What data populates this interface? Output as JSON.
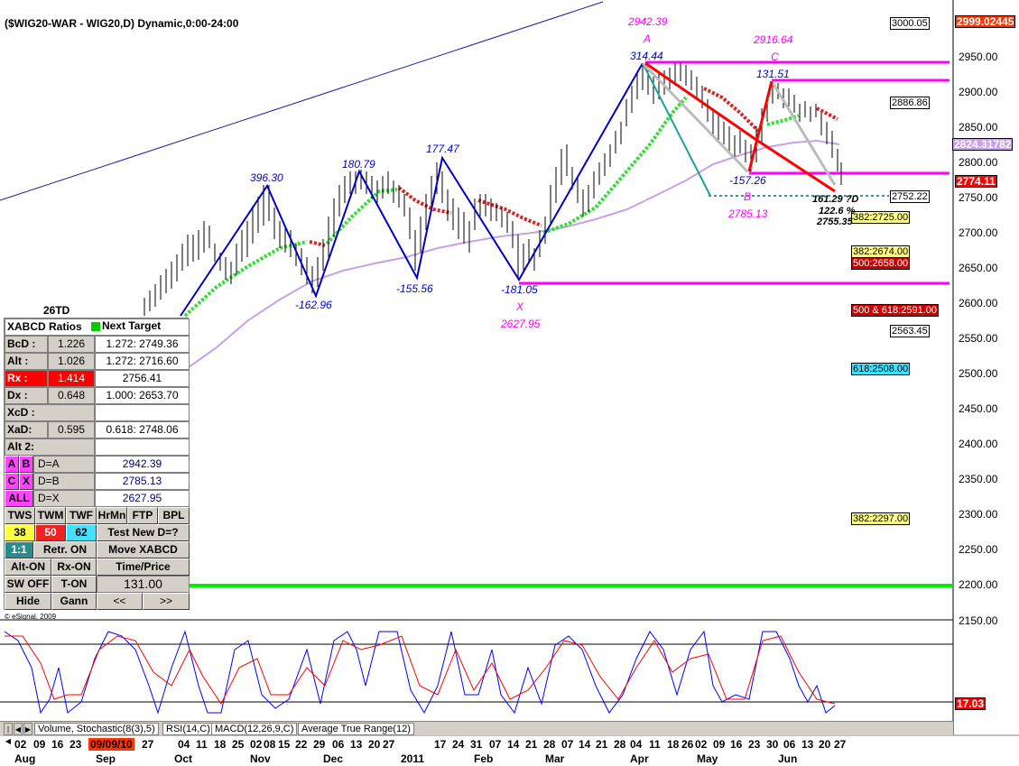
{
  "chart_title": "($WIG20-WAR - WIG20,D) Dynamic,0:00-24:00",
  "copyright": "© eSignal, 2009",
  "colors": {
    "price_axis_highlight": "#ff3300",
    "magenta": "#ff00ff",
    "blue_pattern": "#0000cc",
    "red_pattern": "#ff0000",
    "green_line": "#00ff00",
    "lavender_ma": "#c8a0e8",
    "teal_line": "#20a0a0"
  },
  "price_axis": {
    "ticks": [
      "2950.00",
      "2900.00",
      "2850.00",
      "2800.00",
      "2750.00",
      "2700.00",
      "2650.00",
      "2600.00",
      "2550.00",
      "2500.00",
      "2450.00",
      "2400.00",
      "2350.00",
      "2300.00",
      "2250.00",
      "2200.00",
      "2150.00"
    ],
    "top_price": "2999.02445",
    "mid_price": "2824.31782",
    "last_price": "2774.11",
    "osc_value": "17.03"
  },
  "level_tags": {
    "t3000": "3000.05",
    "t2886": "2886.86",
    "t2752": "2752.22",
    "t2725": "382:2725.00",
    "t2674": "382:2674.00",
    "t2658": "500:2658.00",
    "t2591": "500 & 618:2591.00",
    "t2563": "2563.45",
    "t2508": "618:2508.00",
    "t2297": "382:2297.00"
  },
  "pattern_labels": {
    "a_price": "2942.39",
    "a_letter": "A",
    "c_price": "2916.64",
    "c_letter": "C",
    "b_letter": "B",
    "b_price": "2785.13",
    "x_letter": "X",
    "x_price": "2627.95",
    "r314": "314.44",
    "r131": "131.51",
    "r157": "-157.26",
    "r396": "396.30",
    "r180": "180.79",
    "r177": "177.47",
    "r162": "-162.96",
    "r155": "-155.56",
    "r181": "-181.05",
    "d161": "161.29 ?D",
    "d122": "122.6 %",
    "d2755": "2755.35",
    "td26": "26TD"
  },
  "panel": {
    "header_ratios": "XABCD Ratios",
    "header_target": "Next Target",
    "rows": [
      {
        "label": "BcD :",
        "value": "1.226",
        "target": "1.272: 2749.36"
      },
      {
        "label": "Alt  :",
        "value": "1.026",
        "target": "1.272: 2716.60"
      },
      {
        "label": "Rx  :",
        "value": "1.414",
        "target": "2756.41"
      },
      {
        "label": "Dx  :",
        "value": "0.648",
        "target": "1.000: 2653.70"
      }
    ],
    "xcd": "XcD :",
    "xad_label": "XaD:",
    "xad_value": "0.595",
    "xad_target": "0.618: 2748.06",
    "alt2": "Alt 2:",
    "ab": {
      "a": "A",
      "b": "B",
      "eq": "D=A",
      "val": "2942.39"
    },
    "cx": {
      "c": "C",
      "x": "X",
      "eq": "D=B",
      "val": "2785.13"
    },
    "all": {
      "label": "ALL",
      "eq": "D=X",
      "val": "2627.95"
    },
    "tws": "TWS",
    "twm": "TWM",
    "twf": "TWF",
    "hrmn": "HrMn",
    "ftp": "FTP",
    "bpl": "BPL",
    "n38": "38",
    "n50": "50",
    "n62": "62",
    "test_new": "Test New D=?",
    "ratio11": "1:1",
    "retr_on": "Retr. ON",
    "move_xabcd": "Move XABCD",
    "alt_on": "Alt-ON",
    "rx_on": "Rx-ON",
    "time_price": "Time/Price",
    "sw_off": "SW OFF",
    "t_on": "T-ON",
    "value_131": "131.00",
    "hide": "Hide",
    "gann": "Gann",
    "prev": "<<",
    "next": ">>"
  },
  "tabs": [
    "Volume, Stochastic(8(3),5)",
    "RSI(14,C)",
    "MACD(12,26,9,C)",
    "Average True Range(12)"
  ],
  "dates": [
    "02",
    "09",
    "16",
    "23",
    "09/09/10",
    "27",
    "04",
    "11",
    "18",
    "25",
    "02",
    "08",
    "15",
    "22",
    "29",
    "06",
    "13",
    "20",
    "27",
    "2011",
    "17",
    "24",
    "31",
    "07",
    "14",
    "21",
    "28",
    "07",
    "14",
    "21",
    "28",
    "04",
    "11",
    "18",
    "26",
    "02",
    "09",
    "16",
    "23",
    "30",
    "06",
    "13",
    "20",
    "27"
  ],
  "months": [
    "Aug",
    "Sep",
    "Oct",
    "Nov",
    "Dec",
    "2011",
    "Feb",
    "Mar",
    "Apr",
    "May",
    "Jun"
  ]
}
